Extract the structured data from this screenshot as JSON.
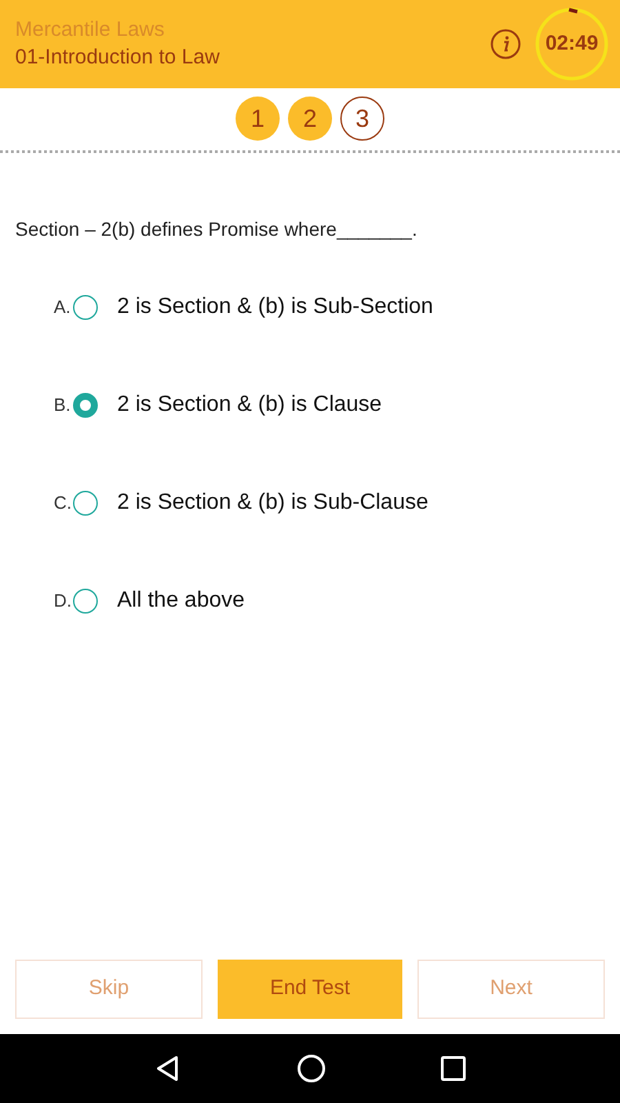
{
  "header": {
    "subject": "Mercantile Laws",
    "chapter": "01-Introduction to Law",
    "timer": "02:49"
  },
  "pager": [
    {
      "label": "1",
      "selected": false
    },
    {
      "label": "2",
      "selected": false
    },
    {
      "label": "3",
      "selected": true
    }
  ],
  "question": "Section – 2(b) defines Promise where_______.",
  "options": [
    {
      "letter": "A.",
      "text": "2 is Section & (b) is Sub-Section",
      "selected": false
    },
    {
      "letter": "B.",
      "text": "2 is Section & (b) is Clause",
      "selected": true
    },
    {
      "letter": "C.",
      "text": "2 is Section & (b) is Sub-Clause",
      "selected": false
    },
    {
      "letter": "D.",
      "text": "All the above",
      "selected": false
    }
  ],
  "buttons": [
    {
      "label": "Skip",
      "kind": "secondary"
    },
    {
      "label": "End Test",
      "kind": "primary"
    },
    {
      "label": "Next",
      "kind": "secondary"
    }
  ]
}
